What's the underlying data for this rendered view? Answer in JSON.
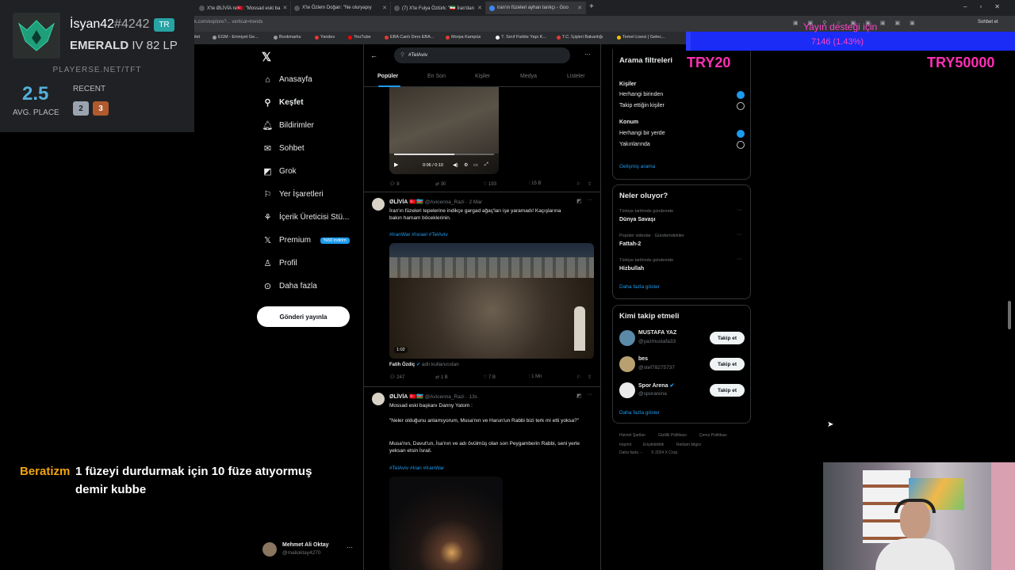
{
  "browser": {
    "tabs": [
      {
        "label": "X'te ØLİVİA re🇹🇷: \"Mossad eski ba"
      },
      {
        "label": "X'te Özlem Doğan: \"Ne oluryapıy"
      },
      {
        "label": "(7) X'te Fulya Öztürk: \"🇮🇷 İran'dan"
      },
      {
        "label": "iran'ın füzeleri ayhan tarıkçı - Goo"
      }
    ],
    "url": "k.com/explore?... vertical=trends",
    "bookmarks": [
      "ilet",
      "EGM - Emniyet Ge...",
      "Bookmarks",
      "Yandex",
      "YouTube",
      "EBA Canlı Ders EBA...",
      "Morpa Kampüs",
      "7. Sınıf Fizikte Yapı K...",
      "T.C. İçişleri Bakanlığı",
      "Temel Lisesi | Gelec..."
    ],
    "profile_label": "Sohbet et"
  },
  "tft": {
    "username": "İsyan42",
    "tag": "#4242",
    "region": "TR",
    "rank": "EMERALD",
    "division_lp": "IV 82 LP",
    "site": "PLAYERSE.NET/TFT",
    "avg_place": "2.5",
    "avg_label": "AVG. PLACE",
    "recent_label": "RECENT",
    "recent": [
      "2",
      "3"
    ]
  },
  "donation": {
    "title": "Yayın desteği için",
    "progress_text": "7146 (1.43%)",
    "progress": 0.0143
  },
  "try_left": "TRY20",
  "try_right": "TRY50000",
  "chat": {
    "user": "Beratizm",
    "message": "1 füzeyi durdurmak için 10 füze atıyormuş demir kubbe"
  },
  "sidebar": {
    "items": [
      {
        "label": "Anasayfa",
        "icon": "home-icon"
      },
      {
        "label": "Keşfet",
        "icon": "search-icon"
      },
      {
        "label": "Bildirimler",
        "icon": "bell-icon"
      },
      {
        "label": "Sohbet",
        "icon": "mail-icon"
      },
      {
        "label": "Grok",
        "icon": "grok-icon"
      },
      {
        "label": "Yer İşaretleri",
        "icon": "bookmark-icon"
      },
      {
        "label": "İçerik Üreticisi Stü...",
        "icon": "creator-icon"
      },
      {
        "label": "Premium",
        "icon": "x-icon"
      },
      {
        "label": "Profil",
        "icon": "user-icon"
      },
      {
        "label": "Daha fazla",
        "icon": "more-icon"
      }
    ],
    "premium_badge": "%50 indirim",
    "post_button": "Gönderi yayınla",
    "account": {
      "name": "Mehmet Ali Oktay",
      "handle": "@malioktay4270"
    }
  },
  "search": {
    "query": "#TelAviv",
    "tabs": [
      "Popüler",
      "En Son",
      "Kişiler",
      "Medya",
      "Listeler"
    ]
  },
  "posts": [
    {
      "video_time": "0:06 / 0:10",
      "replies": "8",
      "reposts": "30",
      "likes": "193",
      "views": "15 B"
    },
    {
      "name": "ØLİVİA",
      "flags": "🇹🇷🇦🇿",
      "handle": "@Avicenna_Razi",
      "time": "· 2 Mar",
      "text": "İran'ın füzeleri tepelerine indikçe gargad ağaç'ları işe yaramadı! Kaçışlarına bakın hamam böceklerinin.",
      "hashtags": "#IranWar #Israel #TelAviv",
      "video_duration": "1:02",
      "tagged_name": "Fatih Özdiç",
      "tagged_note": "adlı kullanıcıdan",
      "replies": "247",
      "reposts": "1 B",
      "likes": "7 B",
      "views": "1 Mn"
    },
    {
      "name": "ØLİVİA",
      "flags": "🇹🇷🇦🇿",
      "handle": "@Avicenna_Razi",
      "time": "· 13s",
      "intro": "Mossad eski başkanı Danny Yatom :",
      "quote": "\"Neler olduğunu anlamıyorum, Musa'nın ve Harun'un Rabbi bizi terk mi etti yoksa?\"",
      "text": "Musa'nın, Davut'un, İsa'nın ve adı övülmüş olan son Peygamberin Rabbi, seni yerle yeksan etsin İsrail.",
      "hashtags": "#TelAviv #Iran #IranWar"
    }
  ],
  "filters": {
    "title": "Arama filtreleri",
    "people_label": "Kişiler",
    "people_options": [
      "Herhangi birinden",
      "Takip ettiğin kişiler"
    ],
    "location_label": "Konum",
    "location_options": [
      "Herhangi bir yerde",
      "Yakınlarında"
    ],
    "advanced": "Gelişmiş arama"
  },
  "trends": {
    "title": "Neler oluyor?",
    "items": [
      {
        "context": "Türkiye tarihinde gündemde",
        "name": "Dünya Savaşı"
      },
      {
        "context": "Popüler videolar · Gündemdekiler",
        "name": "Fattah-2"
      },
      {
        "context": "Türkiye tarihinde gündemde",
        "name": "Hizbullah"
      }
    ],
    "show_more": "Daha fazla göster"
  },
  "who_to_follow": {
    "title": "Kimi takip etmeli",
    "items": [
      {
        "name": "MUSTAFA YAZ",
        "handle": "@yazmustafa33",
        "button": "Takip et"
      },
      {
        "name": "bes",
        "handle": "@stef78275737",
        "button": "Takip et"
      },
      {
        "name": "Spor Arena",
        "handle": "@sporarena",
        "button": "Takip et"
      }
    ],
    "show_more": "Daha fazla göster"
  },
  "footer": [
    "Hizmet Şartları",
    "Gizlilik Politikası",
    "Çerez Politikası",
    "Imprint",
    "Erişilebilirlik",
    "Reklam bilgisi",
    "Daha fazla ···",
    "© 2024 X Corp."
  ]
}
